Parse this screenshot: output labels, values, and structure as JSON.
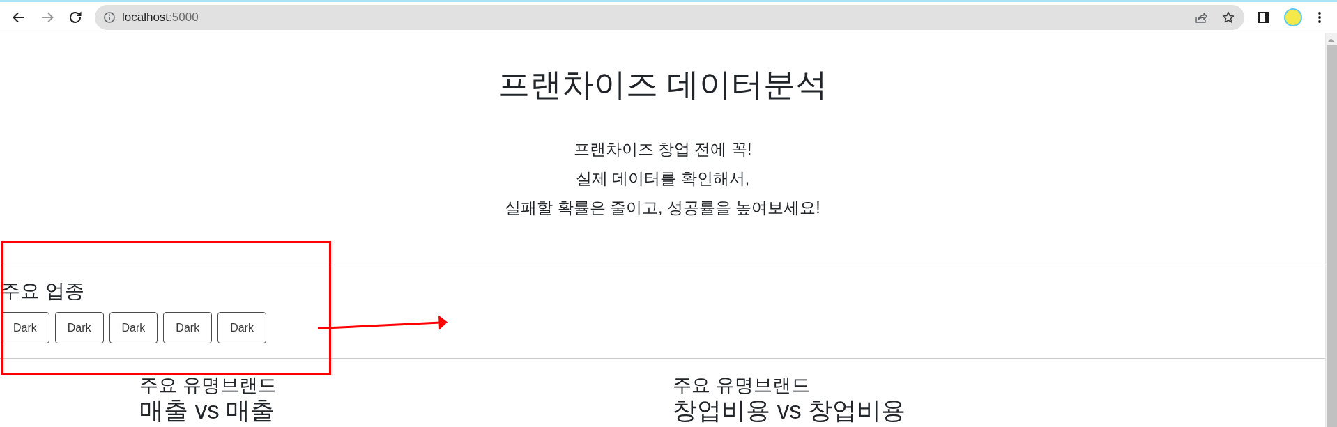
{
  "browser": {
    "back": {
      "disabled": false
    },
    "forward": {
      "disabled": true
    },
    "address": {
      "host": "localhost",
      "port": ":5000"
    }
  },
  "header": {
    "title": "프랜차이즈 데이터분석",
    "intro_lines": [
      "프랜차이즈 창업 전에 꼭!",
      "실제 데이터를 확인해서,",
      "실패할 확률은 줄이고, 성공률을 높여보세요!"
    ]
  },
  "categories": {
    "heading": "주요 업종",
    "buttons": [
      {
        "label": "Dark"
      },
      {
        "label": "Dark"
      },
      {
        "label": "Dark"
      },
      {
        "label": "Dark"
      },
      {
        "label": "Dark"
      }
    ]
  },
  "brand_panels": [
    {
      "label": "주요 유명브랜드",
      "heading": "매출 vs 매출"
    },
    {
      "label": "주요 유명브랜드",
      "heading": "창업비용 vs 창업비용"
    }
  ],
  "annotations": [
    {
      "kind": "box"
    },
    {
      "kind": "arrow"
    }
  ]
}
